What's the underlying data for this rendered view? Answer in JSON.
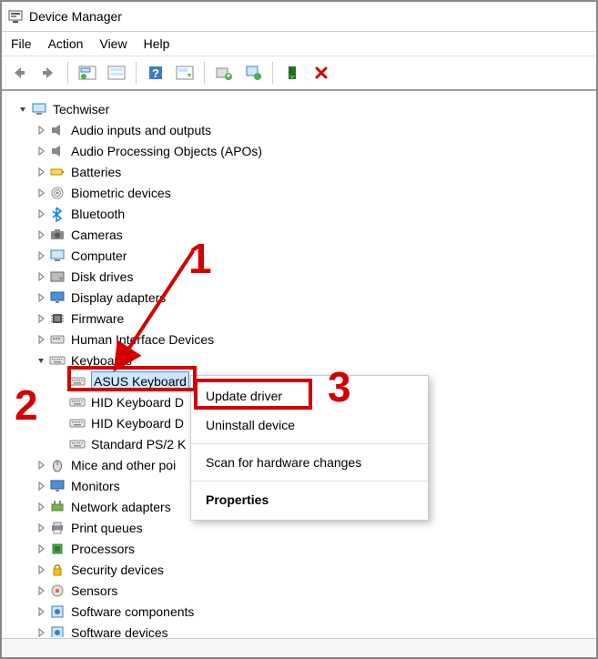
{
  "window": {
    "title": "Device Manager"
  },
  "menus": {
    "file": "File",
    "action": "Action",
    "view": "View",
    "help": "Help"
  },
  "root": {
    "label": "Techwiser"
  },
  "categories": [
    {
      "key": "audio_io",
      "label": "Audio inputs and outputs",
      "icon": "speaker"
    },
    {
      "key": "audio_proc",
      "label": "Audio Processing Objects (APOs)",
      "icon": "speaker"
    },
    {
      "key": "batteries",
      "label": "Batteries",
      "icon": "battery"
    },
    {
      "key": "biometric",
      "label": "Biometric devices",
      "icon": "fingerprint"
    },
    {
      "key": "bluetooth",
      "label": "Bluetooth",
      "icon": "bluetooth"
    },
    {
      "key": "cameras",
      "label": "Cameras",
      "icon": "camera"
    },
    {
      "key": "computer",
      "label": "Computer",
      "icon": "computer"
    },
    {
      "key": "disk",
      "label": "Disk drives",
      "icon": "disk"
    },
    {
      "key": "display",
      "label": "Display adapters",
      "icon": "display"
    },
    {
      "key": "firmware",
      "label": "Firmware",
      "icon": "chip"
    },
    {
      "key": "hid",
      "label": "Human Interface Devices",
      "icon": "hid"
    },
    {
      "key": "keyboards",
      "label": "Keyboards",
      "icon": "keyboard",
      "expanded": true
    },
    {
      "key": "mice",
      "label": "Mice and other poi",
      "icon": "mouse"
    },
    {
      "key": "monitors",
      "label": "Monitors",
      "icon": "monitor"
    },
    {
      "key": "network",
      "label": "Network adapters",
      "icon": "network"
    },
    {
      "key": "print",
      "label": "Print queues",
      "icon": "printer"
    },
    {
      "key": "processors",
      "label": "Processors",
      "icon": "cpu"
    },
    {
      "key": "security",
      "label": "Security devices",
      "icon": "security"
    },
    {
      "key": "sensors",
      "label": "Sensors",
      "icon": "sensor"
    },
    {
      "key": "sw_components",
      "label": "Software components",
      "icon": "software"
    },
    {
      "key": "sw_devices",
      "label": "Software devices",
      "icon": "software"
    }
  ],
  "keyboards_children": [
    {
      "label": "ASUS Keyboard",
      "selected": true
    },
    {
      "label": "HID Keyboard D"
    },
    {
      "label": "HID Keyboard D"
    },
    {
      "label": "Standard PS/2 K"
    }
  ],
  "context_menu": {
    "update": "Update driver",
    "uninstall": "Uninstall device",
    "scan": "Scan for hardware changes",
    "properties": "Properties"
  },
  "annotations": {
    "n1": "1",
    "n2": "2",
    "n3": "3"
  }
}
